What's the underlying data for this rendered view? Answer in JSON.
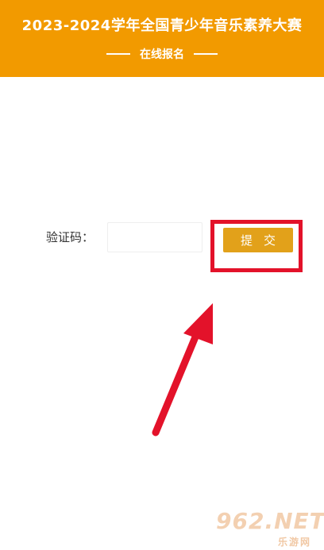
{
  "header": {
    "title": "2023-2024学年全国青少年音乐素养大赛",
    "subtitle": "在线报名"
  },
  "form": {
    "captcha_label": "验证码：",
    "captcha_value": "",
    "submit_label": "提交"
  },
  "watermark": {
    "brand": "962.NET",
    "site": "乐游网"
  },
  "colors": {
    "header_bg": "#f29a00",
    "button_bg": "#e2a11a",
    "highlight": "#e3122a"
  }
}
